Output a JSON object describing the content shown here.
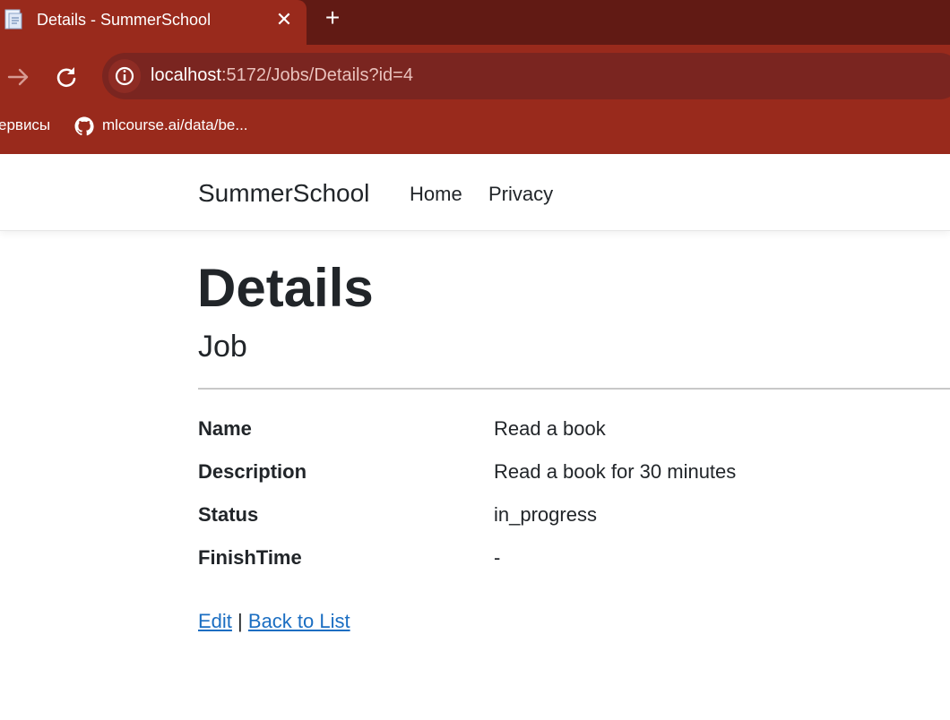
{
  "browser": {
    "tab_title": "Details - SummerSchool",
    "tab_close": "✕",
    "new_tab": "+",
    "url_host": "localhost",
    "url_rest": ":5172/Jobs/Details?id=4",
    "bookmarks": [
      {
        "label": "ервисы",
        "icon": "apps-icon"
      },
      {
        "label": "mlcourse.ai/data/be...",
        "icon": "github-icon"
      }
    ]
  },
  "navbar": {
    "brand": "SummerSchool",
    "links": [
      "Home",
      "Privacy"
    ]
  },
  "main": {
    "title": "Details",
    "subtitle": "Job",
    "fields": [
      {
        "label": "Name",
        "value": "Read a book"
      },
      {
        "label": "Description",
        "value": "Read a book for 30 minutes"
      },
      {
        "label": "Status",
        "value": "in_progress"
      },
      {
        "label": "FinishTime",
        "value": "-"
      }
    ],
    "actions": {
      "edit": "Edit",
      "separator": "|",
      "back": "Back to List"
    }
  },
  "colors": {
    "tab_strip": "#611a14",
    "toolbar": "#992a1c",
    "omnibox": "#7a2520",
    "link": "#1b6ec2",
    "text": "#212529"
  }
}
